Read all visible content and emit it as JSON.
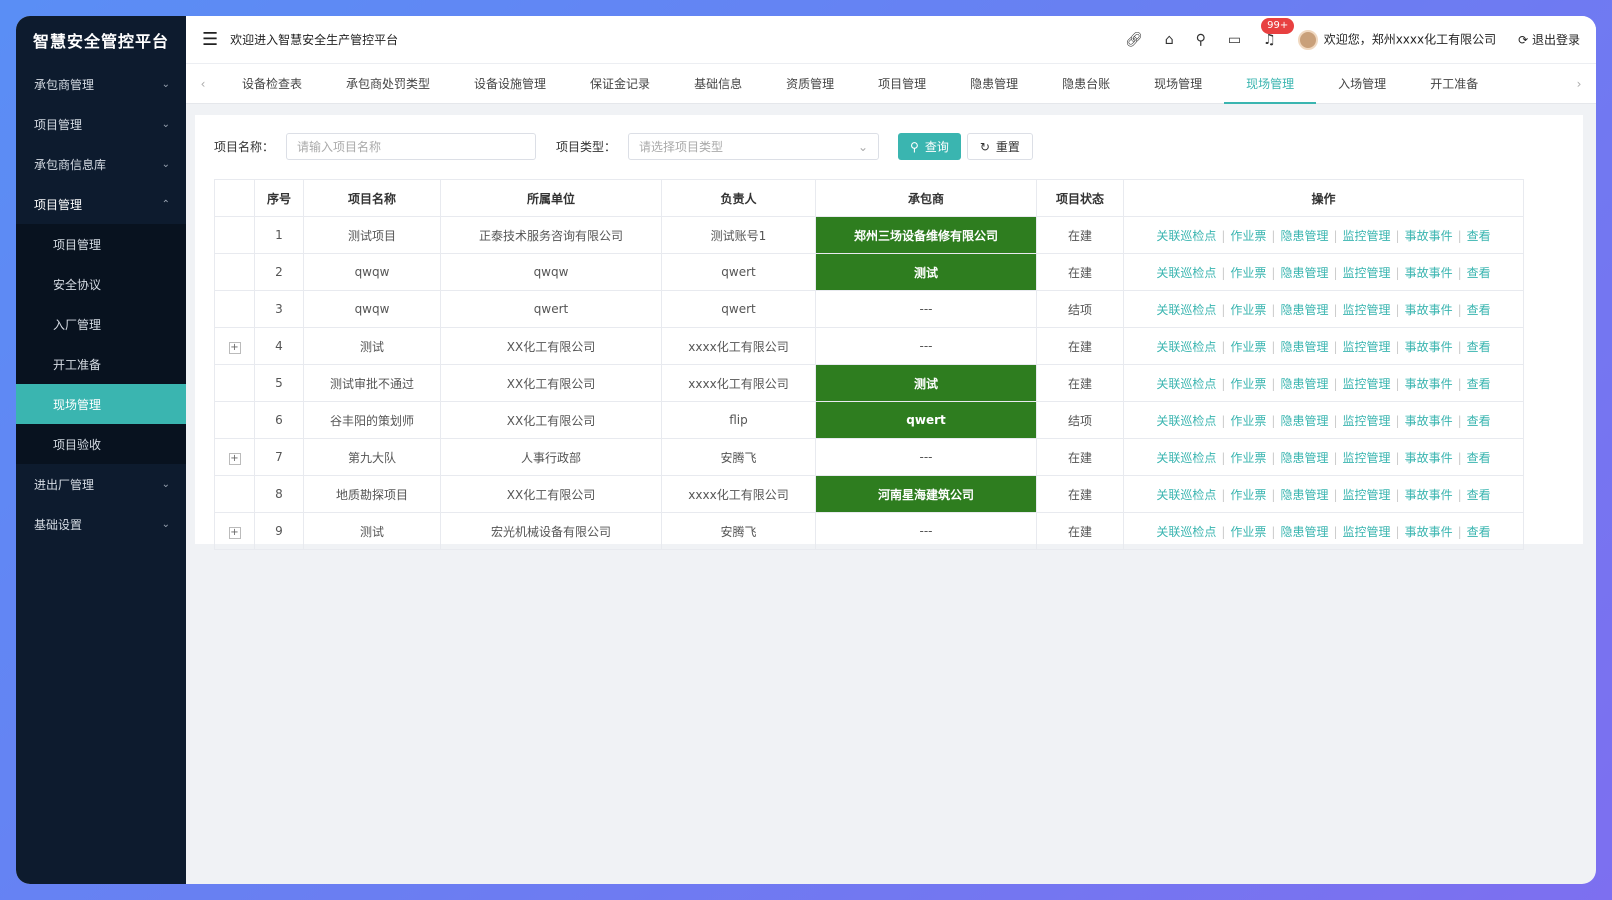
{
  "app": {
    "logo": "智慧安全管控平台",
    "welcome": "欢迎进入智慧安全生产管控平台"
  },
  "header": {
    "badge": "99+",
    "user": "欢迎您，郑州xxxx化工有限公司",
    "logout": "退出登录"
  },
  "sidebar": {
    "items": [
      {
        "label": "承包商管理"
      },
      {
        "label": "项目管理"
      },
      {
        "label": "承包商信息库"
      },
      {
        "label": "项目管理"
      },
      {
        "label": "进出厂管理"
      },
      {
        "label": "基础设置"
      }
    ],
    "sub": [
      "项目管理",
      "安全协议",
      "入厂管理",
      "开工准备",
      "现场管理",
      "项目验收"
    ]
  },
  "tabs": [
    "设备检查表",
    "承包商处罚类型",
    "设备设施管理",
    "保证金记录",
    "基础信息",
    "资质管理",
    "项目管理",
    "隐患管理",
    "隐患台账",
    "现场管理",
    "现场管理",
    "入场管理",
    "开工准备"
  ],
  "search": {
    "name_label": "项目名称：",
    "name_placeholder": "请输入项目名称",
    "type_label": "项目类型：",
    "type_placeholder": "请选择项目类型",
    "query": "查询",
    "reset": "重置"
  },
  "table": {
    "headers": [
      "序号",
      "项目名称",
      "所属单位",
      "负责人",
      "承包商",
      "项目状态",
      "操作"
    ],
    "ops": [
      "关联巡检点",
      "作业票",
      "隐患管理",
      "监控管理",
      "事故事件",
      "查看"
    ],
    "rows": [
      {
        "no": "1",
        "name": "测试项目",
        "unit": "正泰技术服务咨询有限公司",
        "owner": "测试账号1",
        "contractor": "郑州三场设备维修有限公司",
        "status": "在建"
      },
      {
        "no": "2",
        "name": "qwqw",
        "unit": "qwqw",
        "owner": "qwert",
        "contractor": "测试",
        "status": "在建"
      },
      {
        "no": "3",
        "name": "qwqw",
        "unit": "qwert",
        "owner": "qwert",
        "contractor": "---",
        "status": "结项"
      },
      {
        "no": "4",
        "name": "测试",
        "unit": "XX化工有限公司",
        "owner": "xxxx化工有限公司",
        "contractor": "---",
        "status": "在建"
      },
      {
        "no": "5",
        "name": "测试审批不通过",
        "unit": "XX化工有限公司",
        "owner": "xxxx化工有限公司",
        "contractor": "测试",
        "status": "在建"
      },
      {
        "no": "6",
        "name": "谷丰阳的策划师",
        "unit": "XX化工有限公司",
        "owner": "flip",
        "contractor": "qwert",
        "status": "结项"
      },
      {
        "no": "7",
        "name": "第九大队",
        "unit": "人事行政部",
        "owner": "安腾飞",
        "contractor": "---",
        "status": "在建"
      },
      {
        "no": "8",
        "name": "地质勘探项目",
        "unit": "XX化工有限公司",
        "owner": "xxxx化工有限公司",
        "contractor": "河南星海建筑公司",
        "status": "在建"
      },
      {
        "no": "9",
        "name": "测试",
        "unit": "宏光机械设备有限公司",
        "owner": "安腾飞",
        "contractor": "---",
        "status": "在建"
      }
    ]
  },
  "colors": {
    "accent": "#3ab5b0",
    "sidebar": "#0d1b2e",
    "contractor_green": "#2e7d1f"
  }
}
